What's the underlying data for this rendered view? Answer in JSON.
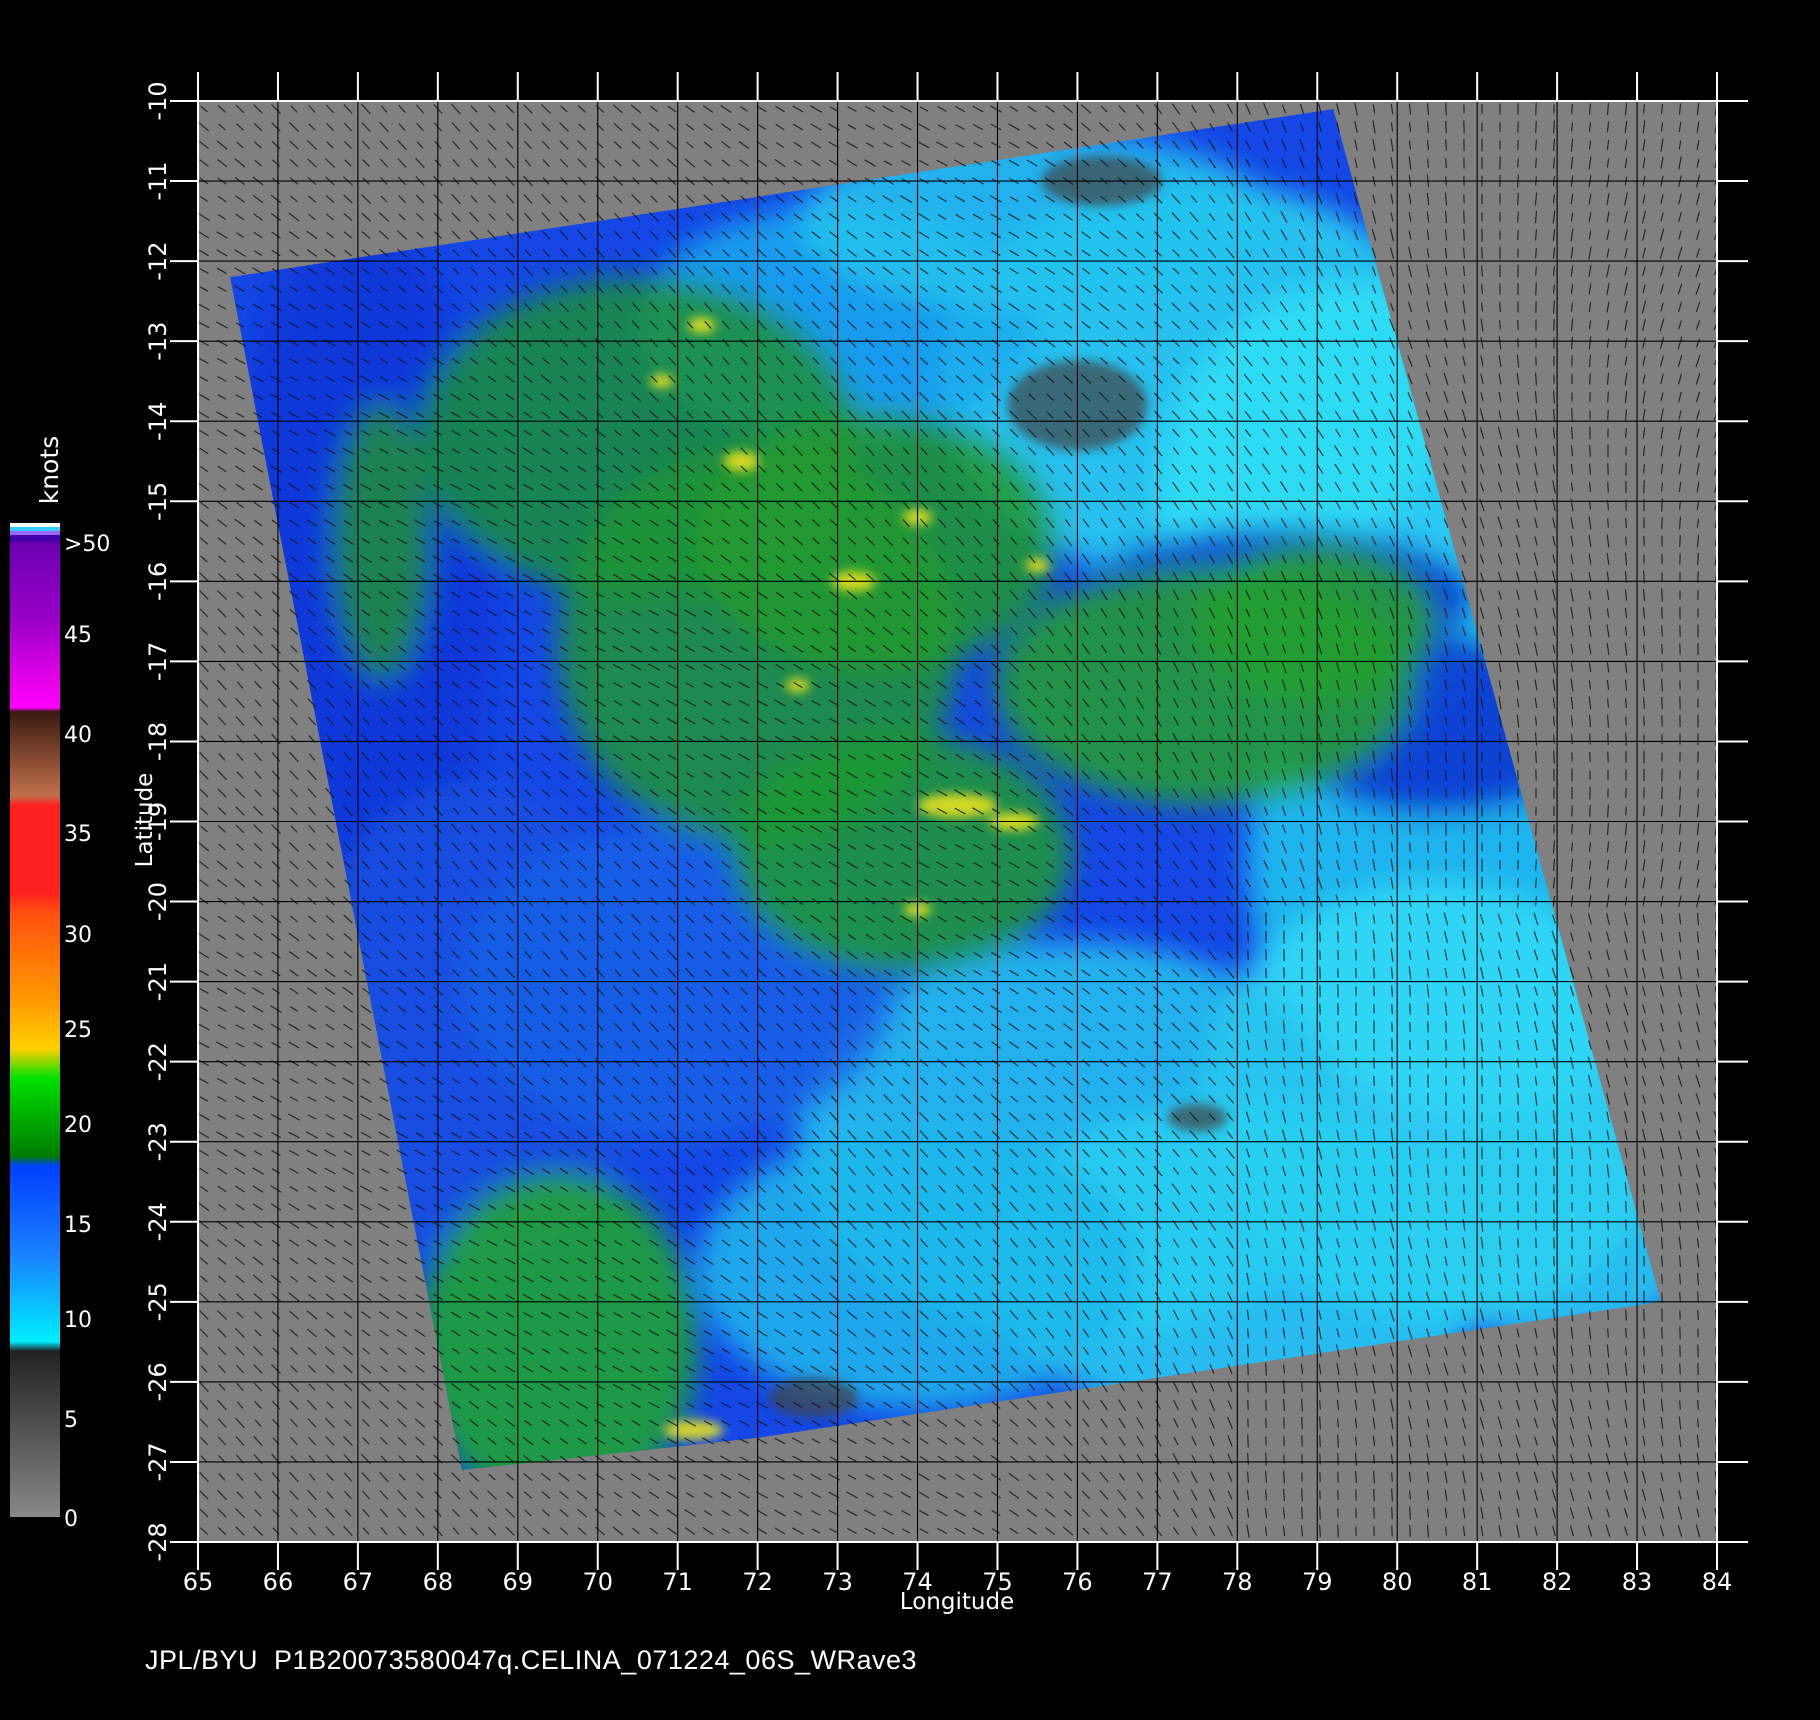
{
  "map": {
    "type": "scatterometer-wind-map",
    "x_axis": {
      "label": "Longitude",
      "range": [
        65,
        84
      ],
      "ticks": [
        "65",
        "66",
        "67",
        "68",
        "69",
        "70",
        "71",
        "72",
        "73",
        "74",
        "75",
        "76",
        "77",
        "78",
        "79",
        "80",
        "81",
        "82",
        "83",
        "84"
      ]
    },
    "y_axis": {
      "label": "Latitude",
      "range": [
        -28,
        -10
      ],
      "ticks": [
        "-10",
        "-11",
        "-12",
        "-13",
        "-14",
        "-15",
        "-16",
        "-17",
        "-18",
        "-19",
        "-20",
        "-21",
        "-22",
        "-23",
        "-24",
        "-25",
        "-26",
        "-27",
        "-28"
      ]
    },
    "grid": true,
    "background_color": "#808080",
    "swath_corners_lonlat": [
      [
        65.4,
        -12.2
      ],
      [
        79.2,
        -10.1
      ],
      [
        83.3,
        -25.0
      ],
      [
        72.0,
        -26.7
      ],
      [
        68.3,
        -27.1
      ]
    ],
    "high_wind_regions": [
      {
        "lon": 71.0,
        "lat": -14.5,
        "level": "15-20"
      },
      {
        "lon": 72.5,
        "lat": -16.5,
        "level": "15-20"
      },
      {
        "lon": 77.5,
        "lat": -17.3,
        "level": "15-20"
      },
      {
        "lon": 74.0,
        "lat": -19.5,
        "level": "15-20"
      },
      {
        "lon": 69.5,
        "lat": -25.8,
        "level": "15-20"
      }
    ]
  },
  "colorbar": {
    "title": "knots",
    "labels": [
      ">50",
      "45",
      "40",
      "35",
      "30",
      "25",
      "20",
      "15",
      "10",
      "5",
      "0"
    ],
    "colors": [
      "#7700cc",
      "#aa00cc",
      "#ff00ff",
      "#8b4513",
      "#ff2020",
      "#ff4a00",
      "#ff9900",
      "#ffcc00",
      "#00aa00",
      "#0044ff",
      "#00ffff",
      "#555555"
    ]
  },
  "footer": {
    "text": "JPL/BYU  P1B20073580047q.CELINA_071224_06S_WRave3"
  }
}
